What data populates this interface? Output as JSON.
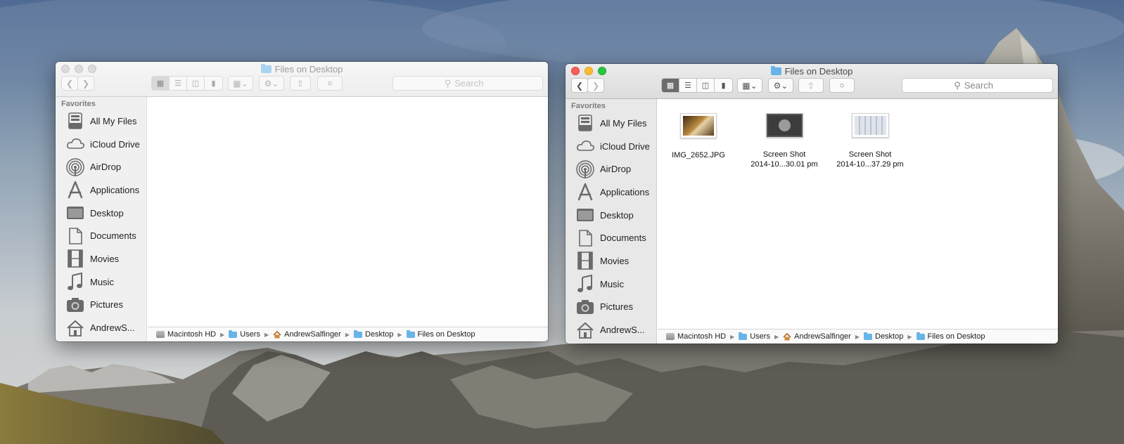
{
  "windows": [
    {
      "id": "inactive",
      "title": "Files on Desktop",
      "search_placeholder": "Search",
      "sidebar_heading": "Favorites",
      "sidebar_items": [
        {
          "label": "All My Files",
          "icon": "all-my-files-icon"
        },
        {
          "label": "iCloud Drive",
          "icon": "icloud-icon"
        },
        {
          "label": "AirDrop",
          "icon": "airdrop-icon"
        },
        {
          "label": "Applications",
          "icon": "applications-icon"
        },
        {
          "label": "Desktop",
          "icon": "desktop-icon"
        },
        {
          "label": "Documents",
          "icon": "documents-icon"
        },
        {
          "label": "Movies",
          "icon": "movies-icon"
        },
        {
          "label": "Music",
          "icon": "music-icon"
        },
        {
          "label": "Pictures",
          "icon": "pictures-icon"
        },
        {
          "label": "AndrewS...",
          "icon": "home-icon"
        }
      ],
      "path": [
        "Macintosh HD",
        "Users",
        "AndrewSalfinger",
        "Desktop",
        "Files on Desktop"
      ],
      "files": []
    },
    {
      "id": "active",
      "title": "Files on Desktop",
      "search_placeholder": "Search",
      "sidebar_heading": "Favorites",
      "sidebar_items": [
        {
          "label": "All My Files",
          "icon": "all-my-files-icon"
        },
        {
          "label": "iCloud Drive",
          "icon": "icloud-icon"
        },
        {
          "label": "AirDrop",
          "icon": "airdrop-icon"
        },
        {
          "label": "Applications",
          "icon": "applications-icon"
        },
        {
          "label": "Desktop",
          "icon": "desktop-icon"
        },
        {
          "label": "Documents",
          "icon": "documents-icon"
        },
        {
          "label": "Movies",
          "icon": "movies-icon"
        },
        {
          "label": "Music",
          "icon": "music-icon"
        },
        {
          "label": "Pictures",
          "icon": "pictures-icon"
        },
        {
          "label": "AndrewS...",
          "icon": "home-icon"
        }
      ],
      "path": [
        "Macintosh HD",
        "Users",
        "AndrewSalfinger",
        "Desktop",
        "Files on Desktop"
      ],
      "files": [
        {
          "line1": "IMG_2652.JPG",
          "line2": ""
        },
        {
          "line1": "Screen Shot",
          "line2": "2014-10...30.01 pm"
        },
        {
          "line1": "Screen Shot",
          "line2": "2014-10...37.29 pm"
        }
      ]
    }
  ],
  "colors": {
    "close": "#fc5f57",
    "minimize": "#fdbc2e",
    "zoom": "#28c840",
    "folder": "#67b4e8"
  }
}
